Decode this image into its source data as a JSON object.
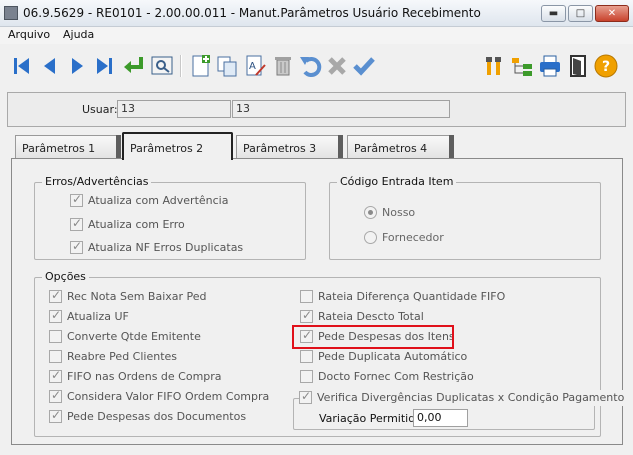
{
  "window": {
    "title": "06.9.5629 - RE0101 - 2.00.00.011 - Manut.Parâmetros Usuário Recebimento",
    "minimize_glyph": "▬",
    "maximize_glyph": "□",
    "close_glyph": "✕"
  },
  "menu": {
    "items": [
      "Arquivo",
      "Ajuda"
    ]
  },
  "toolbar": {
    "icons": [
      "first-icon",
      "previous-icon",
      "next-icon",
      "last-icon",
      "goto-icon",
      "search-icon",
      "new-icon",
      "copy-icon",
      "edit-icon",
      "delete-icon",
      "undo-icon",
      "cancel-icon",
      "save-icon",
      "tools-icon",
      "tree-icon",
      "print-icon",
      "exit-icon",
      "help-icon"
    ],
    "help_glyph": "?"
  },
  "header": {
    "user_label": "Usuar:",
    "user_code": "13",
    "user_name": "13"
  },
  "tabs": [
    {
      "label": "Parâmetros 1",
      "active": false
    },
    {
      "label": "Parâmetros 2",
      "active": true
    },
    {
      "label": "Parâmetros 3",
      "active": false
    },
    {
      "label": "Parâmetros 4",
      "active": false
    }
  ],
  "errors_group": {
    "title": "Erros/Advertências",
    "items": [
      {
        "label": "Atualiza com Advertência",
        "checked": true
      },
      {
        "label": "Atualiza com Erro",
        "checked": true
      },
      {
        "label": "Atualiza NF Erros Duplicatas",
        "checked": true
      }
    ]
  },
  "entry_code_group": {
    "title": "Código Entrada Item",
    "options": [
      {
        "label": "Nosso",
        "selected": true
      },
      {
        "label": "Fornecedor",
        "selected": false
      }
    ]
  },
  "options_group": {
    "title": "Opções",
    "left": [
      {
        "label": "Rec Nota Sem Baixar Ped",
        "checked": true
      },
      {
        "label": "Atualiza UF",
        "checked": true
      },
      {
        "label": "Converte Qtde Emitente",
        "checked": false
      },
      {
        "label": "Reabre Ped Clientes",
        "checked": false
      },
      {
        "label": "FIFO nas Ordens de Compra",
        "checked": true
      },
      {
        "label": "Considera Valor FIFO Ordem Compra",
        "checked": true
      },
      {
        "label": "Pede Despesas dos Documentos",
        "checked": true
      }
    ],
    "right": [
      {
        "label": "Rateia Diferença Quantidade FIFO",
        "checked": false
      },
      {
        "label": "Rateia Descto Total",
        "checked": true
      },
      {
        "label": "Pede Despesas dos Itens",
        "checked": true
      },
      {
        "label": "Pede Duplicata Automático",
        "checked": false
      },
      {
        "label": "Docto Fornec Com Restrição",
        "checked": false
      }
    ],
    "divergence": {
      "label": "Verifica Divergências Duplicatas x Condição Pagamento",
      "checked": true,
      "variation_label": "Variação Permitida:",
      "variation_value": "0,00"
    }
  },
  "colors": {
    "highlight": "#e0101a",
    "nav_blue": "#2a6fc9",
    "help_orange": "#f0a000"
  }
}
